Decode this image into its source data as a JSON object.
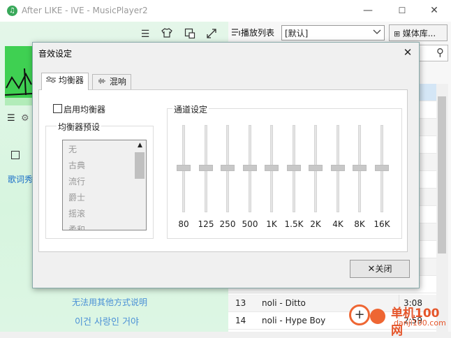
{
  "window": {
    "title": "After LIKE - IVE - MusicPlayer2",
    "minimize": "—",
    "maximize": "☐",
    "close": "✕"
  },
  "playlist_bar": {
    "label": "播放列表",
    "select_value": "[默认]",
    "media_lib_label": "媒体库..."
  },
  "left_panel": {
    "lyrics_label": "歌词秀",
    "link_text": "无法用其他方式说明",
    "lyric_text": "이건 사랑인 거야"
  },
  "playlist": {
    "rows": [
      {
        "num": "13",
        "name": "noli - Ditto",
        "duration": "3:08"
      },
      {
        "num": "14",
        "name": "noli - Hype Boy",
        "duration": "2:59"
      }
    ]
  },
  "dialog": {
    "title": "音效设定",
    "close_icon": "close-icon",
    "tabs": [
      {
        "label": "均衡器",
        "icon": "sliders-icon"
      },
      {
        "label": "混响",
        "icon": "waveform-icon"
      }
    ],
    "enable_eq_label": "启用均衡器",
    "enable_eq_checked": false,
    "preset_group_title": "均衡器预设",
    "presets": [
      "无",
      "古典",
      "流行",
      "爵士",
      "摇滚",
      "柔和"
    ],
    "channel_group_title": "通道设定",
    "bands": [
      "80",
      "125",
      "250",
      "500",
      "1K",
      "1.5K",
      "2K",
      "4K",
      "8K",
      "16K"
    ],
    "band_levels": [
      0,
      0,
      0,
      0,
      0,
      0,
      0,
      0,
      0,
      0
    ],
    "close_button_label": "关闭"
  },
  "watermark": {
    "text": "单机100网",
    "subtext": "danji100.com"
  }
}
